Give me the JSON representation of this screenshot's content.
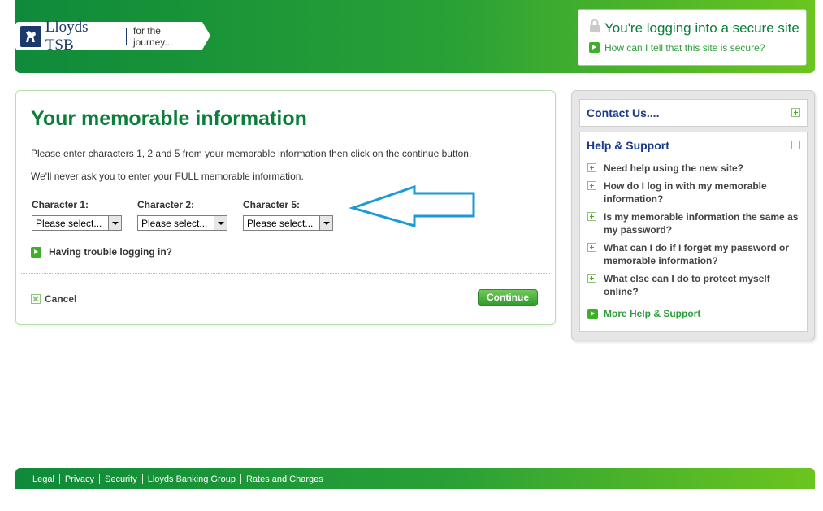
{
  "header": {
    "logo_name": "Lloyds TSB",
    "logo_tagline": "for the journey...",
    "secure_title": "You're logging into a secure site",
    "secure_link": "How can I tell that this site is secure?"
  },
  "main": {
    "title": "Your memorable information",
    "instruction": "Please enter characters 1, 2 and 5 from your memorable information then click on the continue button.",
    "warning": "We'll never ask you to enter your FULL memorable information.",
    "characters": [
      {
        "label": "Character 1:",
        "value": "Please select..."
      },
      {
        "label": "Character 2:",
        "value": "Please select..."
      },
      {
        "label": "Character 5:",
        "value": "Please select..."
      }
    ],
    "trouble_link": "Having trouble logging in?",
    "cancel_label": "Cancel",
    "continue_label": "Continue"
  },
  "sidebar": {
    "contact_title": "Contact Us....",
    "help_title": "Help & Support",
    "help_items": [
      "Need help using the new site?",
      "How do I log in with my memorable information?",
      "Is my memorable information the same as my password?",
      "What can I do if I forget my password or memorable information?",
      "What else can I do to protect myself online?"
    ],
    "more_help": "More Help & Support"
  },
  "footer": {
    "links": [
      "Legal",
      "Privacy",
      "Security",
      "Lloyds Banking Group",
      "Rates and Charges"
    ]
  },
  "colors": {
    "brand_green": "#0a7f3a",
    "link_blue": "#1b3a8c",
    "annotation_arrow": "#1a9ad6"
  }
}
